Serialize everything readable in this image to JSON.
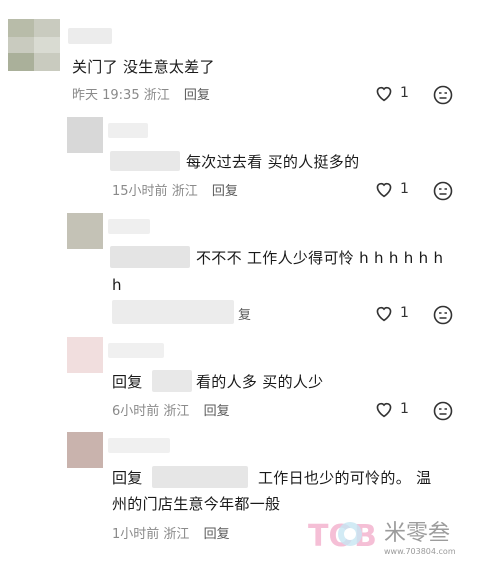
{
  "comments": [
    {
      "text": "关门了 没生意太差了",
      "time": "昨天 19:35",
      "location": "浙江",
      "reply_label": "回复",
      "likes": "1"
    },
    {
      "text": "每次过去看 买的人挺多的",
      "time": "15小时前",
      "location": "浙江",
      "reply_label": "回复",
      "likes": "1"
    },
    {
      "text_line1": "不不不 工作人少得可怜 h h h h h h",
      "text_line2": "h",
      "meta_tail": "复",
      "likes": "1"
    },
    {
      "prefix": "回复",
      "text": "看的人多 买的人少",
      "time": "6小时前",
      "location": "浙江",
      "reply_label": "回复",
      "likes": "1"
    },
    {
      "prefix": "回复",
      "text_line1": "工作日也少的可怜的。 温",
      "text_line2": "州的门店生意今年都一般",
      "time": "1小时前",
      "location": "浙江",
      "reply_label": "回复"
    }
  ],
  "watermark": {
    "logo": "TOB",
    "name": "米零叁",
    "url": "www.703804.com"
  },
  "icons": {
    "like": "heart-outline-icon",
    "dislike": "neutral-face-icon"
  }
}
